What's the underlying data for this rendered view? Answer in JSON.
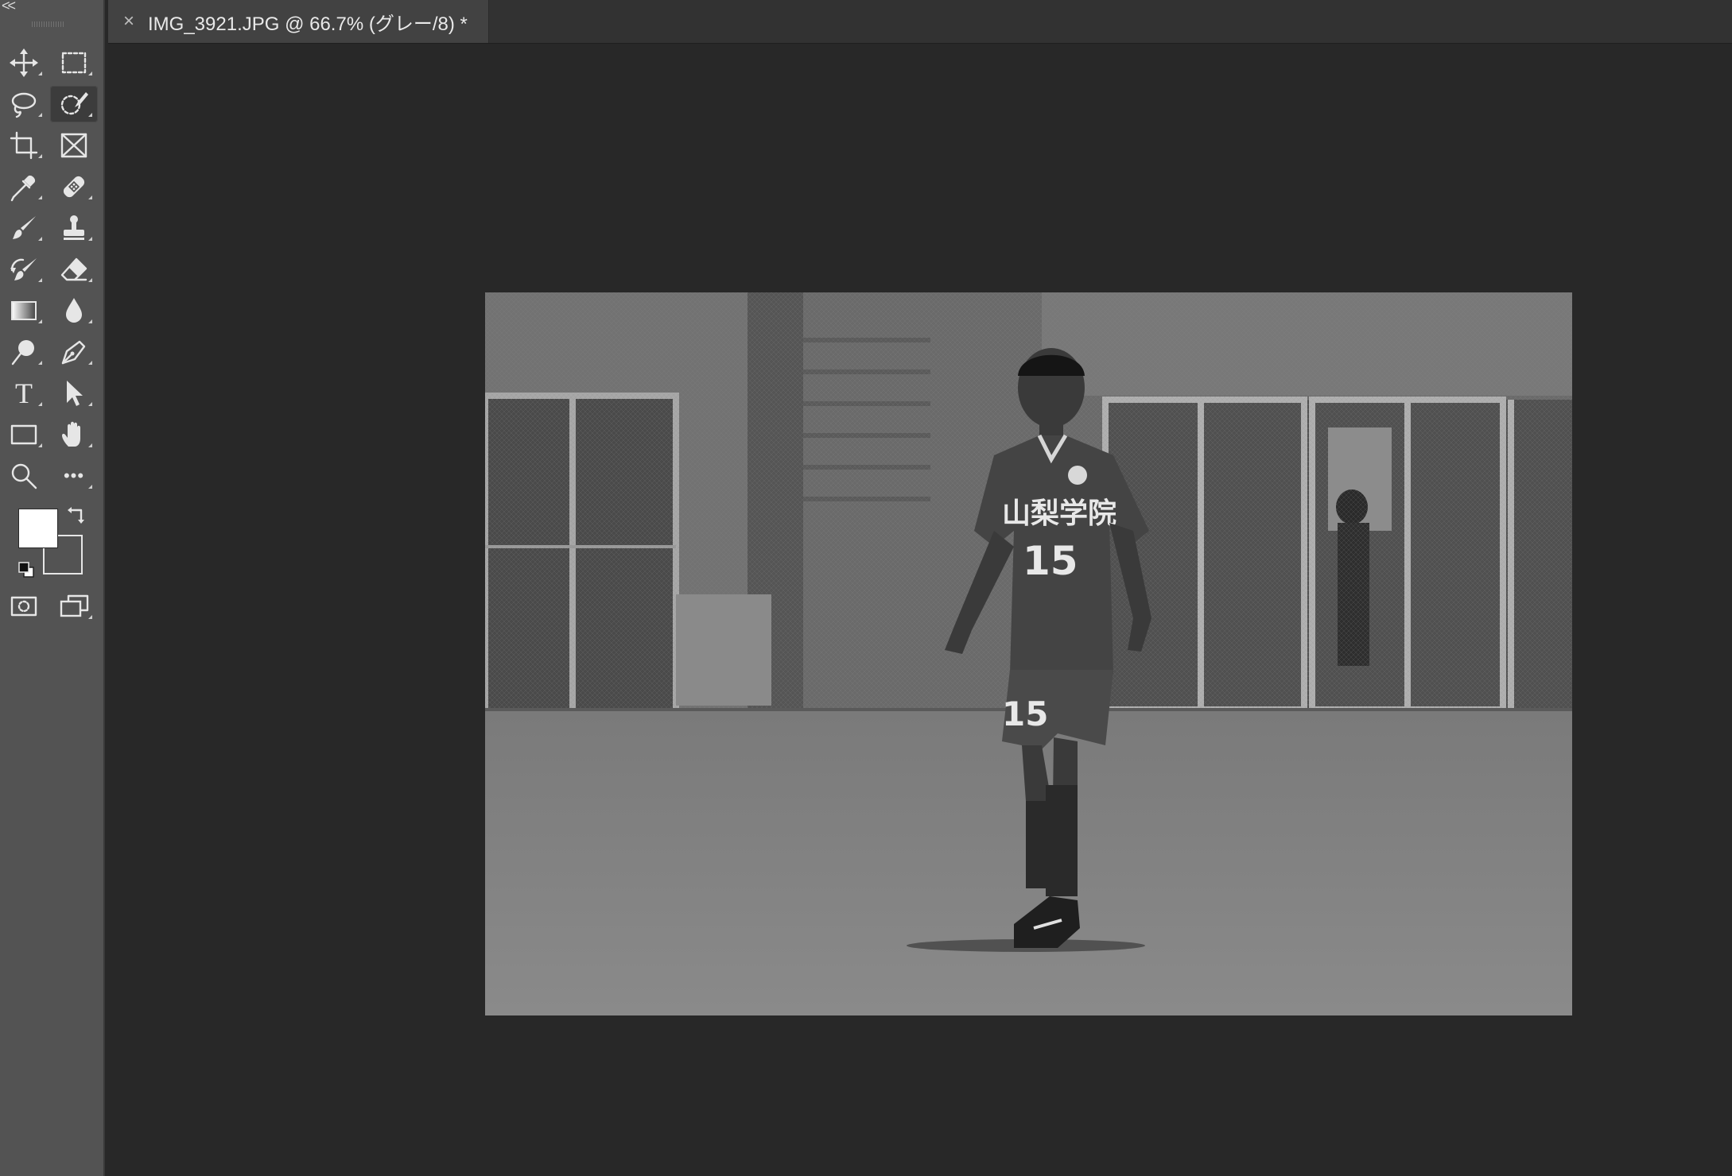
{
  "toolbar": {
    "collapse_label": "<<",
    "tools": [
      {
        "icon": "move-icon"
      },
      {
        "icon": "rectangular-marquee-icon"
      },
      {
        "icon": "lasso-icon"
      },
      {
        "icon": "object-selection-icon",
        "active": true
      },
      {
        "icon": "crop-icon"
      },
      {
        "icon": "frame-icon"
      },
      {
        "icon": "eyedropper-icon"
      },
      {
        "icon": "healing-brush-icon"
      },
      {
        "icon": "brush-icon"
      },
      {
        "icon": "clone-stamp-icon"
      },
      {
        "icon": "history-brush-icon"
      },
      {
        "icon": "eraser-icon"
      },
      {
        "icon": "gradient-icon"
      },
      {
        "icon": "blur-icon"
      },
      {
        "icon": "dodge-icon"
      },
      {
        "icon": "pen-icon"
      },
      {
        "icon": "type-icon",
        "glyph": "T"
      },
      {
        "icon": "path-selection-icon"
      },
      {
        "icon": "rectangle-shape-icon"
      },
      {
        "icon": "hand-icon"
      },
      {
        "icon": "zoom-icon"
      },
      {
        "icon": "more-tools-icon",
        "glyph": "•••"
      },
      {
        "icon": "quick-mask-icon"
      },
      {
        "icon": "screen-mode-icon"
      }
    ],
    "foreground_color": "#ffffff",
    "background_color": "#535353"
  },
  "document": {
    "tab_close": "×",
    "tab_title": "IMG_3921.JPG @ 66.7% (グレー/8) *",
    "jersey_text": "山梨学院",
    "jersey_number": "15"
  },
  "colors": {
    "panel": "#535353",
    "canvas_bg": "#282828",
    "tabbar": "#323232",
    "active_tab": "#424242"
  }
}
